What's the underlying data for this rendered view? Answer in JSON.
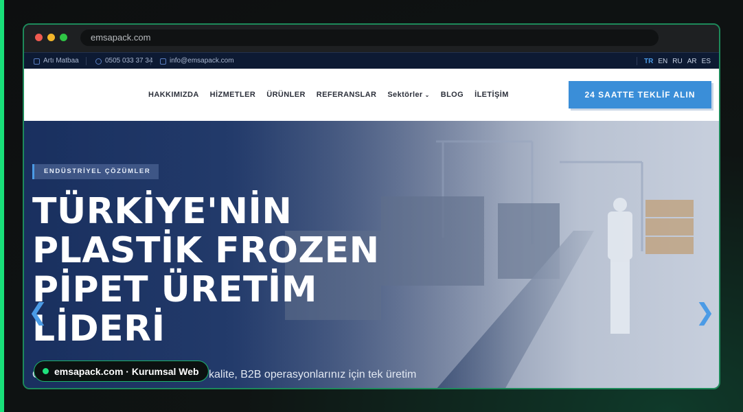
{
  "browser": {
    "url": "emsapack.com"
  },
  "topbar": {
    "company": "Artı Matbaa",
    "phone": "0505 033 37 34",
    "email": "info@emsapack.com",
    "languages": [
      {
        "code": "TR",
        "active": true
      },
      {
        "code": "EN",
        "active": false
      },
      {
        "code": "RU",
        "active": false
      },
      {
        "code": "AR",
        "active": false
      },
      {
        "code": "ES",
        "active": false
      }
    ]
  },
  "nav": {
    "items": [
      "HAKKIMIZDA",
      "HİZMETLER",
      "ÜRÜNLER",
      "REFERANSLAR",
      "Sektörler",
      "BLOG",
      "İLETİŞİM"
    ],
    "cta": "24 SAATTE TEKLİF ALIN"
  },
  "hero": {
    "badge": "ENDÜSTRİYEL ÇÖZÜMLER",
    "headline": [
      "TÜRKİYE'NİN",
      "PLASTİK FROZEN",
      "PİPET ÜRETİM",
      "LİDERİ"
    ],
    "subtitle": "Özel baskılı ambalaj tasarımı, stabil kalite, B2B operasyonlarınız için tek üretim",
    "prev_icon": "chevron-left-icon",
    "next_icon": "chevron-right-icon"
  },
  "watermark": {
    "label": "emsapack.com · Kurumsal Web"
  },
  "colors": {
    "accent": "#3a8ed8",
    "topbar": "#0d1a33",
    "brand_green": "#1fe07c"
  }
}
